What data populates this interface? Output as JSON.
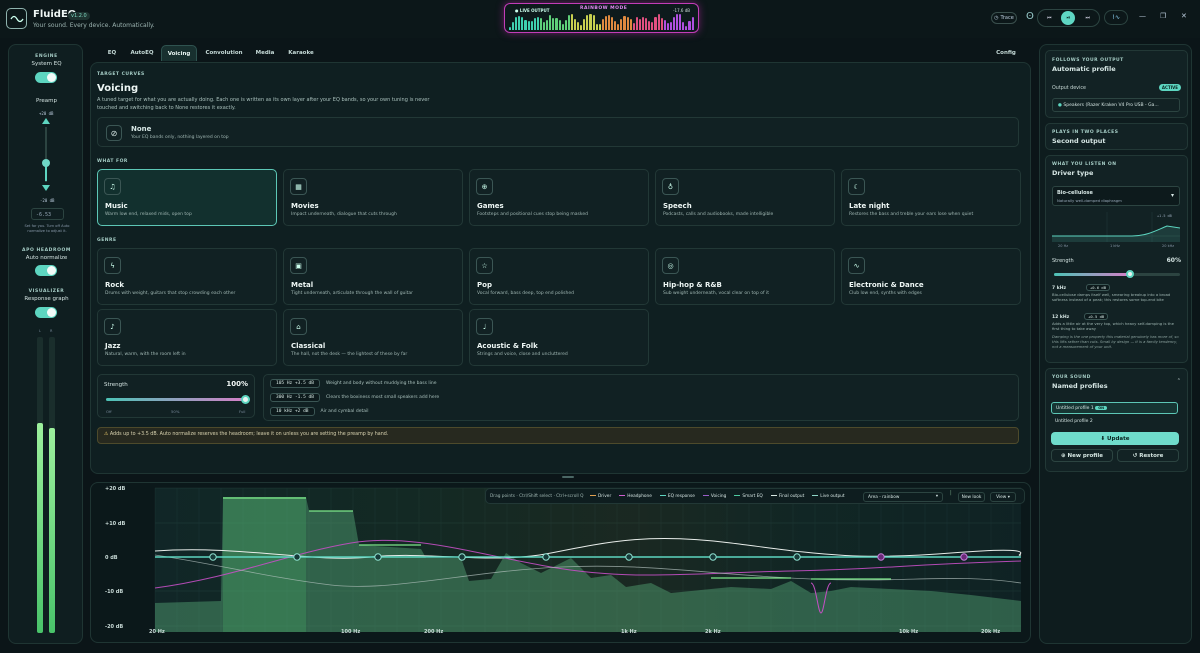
{
  "app": {
    "name": "FluidEQ",
    "version": "v1.2.0",
    "tagline": "Your sound. Every device. Automatically."
  },
  "live": {
    "label": "LIVE OUTPUT",
    "mode": "RAINBOW MODE",
    "level": "-17.6 dB"
  },
  "toolbar": {
    "trace": "Trace"
  },
  "left": {
    "engine_cap": "ENGINE",
    "engine_label": "System EQ",
    "preamp_label": "Preamp",
    "preamp_max": "+20 dB",
    "preamp_min": "-20 dB",
    "preamp_value": "-6.53",
    "preamp_hint": "Set for you. Turn off Auto normalize to adjust it.",
    "headroom_cap": "APO HEADROOM",
    "headroom_label": "Auto normalize",
    "visualizer_cap": "VISUALIZER",
    "visualizer_label": "Response graph",
    "meter_l": "L",
    "meter_r": "R"
  },
  "tabs": [
    "EQ",
    "AutoEQ",
    "Voicing",
    "Convolution",
    "Media",
    "Karaoke"
  ],
  "config_tab": "Config",
  "voicing": {
    "cap": "TARGET CURVES",
    "title": "Voicing",
    "desc": "A tuned target for what you are actually doing. Each one is written as its own layer after your EQ bands, so your own tuning is never touched and switching back to None restores it exactly.",
    "none_title": "None",
    "none_desc": "Your EQ bands only, nothing layered on top",
    "what_for_cap": "WHAT FOR",
    "what_for": [
      {
        "icon": "music-note-icon",
        "glyph": "♫",
        "title": "Music",
        "desc": "Warm low end, relaxed mids, open top"
      },
      {
        "icon": "film-icon",
        "glyph": "▦",
        "title": "Movies",
        "desc": "Impact underneath, dialogue that cuts through"
      },
      {
        "icon": "gamepad-icon",
        "glyph": "⊕",
        "title": "Games",
        "desc": "Footsteps and positional cues stop being masked"
      },
      {
        "icon": "microphone-icon",
        "glyph": "♁",
        "title": "Speech",
        "desc": "Podcasts, calls and audiobooks, made intelligible"
      },
      {
        "icon": "moon-icon",
        "glyph": "☾",
        "title": "Late night",
        "desc": "Restores the bass and treble your ears lose when quiet"
      }
    ],
    "genre_cap": "GENRE",
    "genres": [
      {
        "icon": "lightning-icon",
        "glyph": "ϟ",
        "title": "Rock",
        "desc": "Drums with weight, guitars that stop crowding each other"
      },
      {
        "icon": "amp-icon",
        "glyph": "▣",
        "title": "Metal",
        "desc": "Tight underneath, articulate through the wall of guitar"
      },
      {
        "icon": "star-icon",
        "glyph": "☆",
        "title": "Pop",
        "desc": "Vocal forward, bass deep, top end polished"
      },
      {
        "icon": "vinyl-icon",
        "glyph": "◎",
        "title": "Hip-hop & R&B",
        "desc": "Sub weight underneath, vocal clear on top of it"
      },
      {
        "icon": "pulse-icon",
        "glyph": "∿",
        "title": "Electronic & Dance",
        "desc": "Club low end, synths with edges"
      },
      {
        "icon": "saxophone-icon",
        "glyph": "♪",
        "title": "Jazz",
        "desc": "Natural, warm, with the room left in"
      },
      {
        "icon": "column-icon",
        "glyph": "⌂",
        "title": "Classical",
        "desc": "The hall, not the desk — the lightest of these by far"
      },
      {
        "icon": "guitar-icon",
        "glyph": "♩",
        "title": "Acoustic & Folk",
        "desc": "Strings and voice, close and uncluttered"
      }
    ],
    "strength_label": "Strength",
    "strength_value": "100%",
    "strength_fraction": 1.0,
    "scale": [
      "Off",
      "50%",
      "Full"
    ],
    "bands": [
      {
        "chip": "105 Hz +3.5 dB",
        "desc": "Weight and body without muddying the bass line"
      },
      {
        "chip": "300 Hz -1.5 dB",
        "desc": "Clears the boxiness most small speakers add here"
      },
      {
        "chip": "10 kHz +2 dB",
        "desc": "Air and cymbal detail"
      }
    ],
    "warning": "Adds up to +3.5 dB. Auto normalize reserves the headroom; leave it on unless you are setting the preamp by hand."
  },
  "graph": {
    "y_labels": [
      "+20 dB",
      "+10 dB",
      "0 dB",
      "-10 dB",
      "-20 dB"
    ],
    "x_labels": [
      "20 Hz",
      "100 Hz",
      "200 Hz",
      "1k Hz",
      "2k Hz",
      "10k Hz",
      "20k Hz"
    ],
    "hint": "Drag points · Ctrl/Shift select · Ctrl+scroll Q",
    "legend": [
      {
        "name": "Driver",
        "color": "#e0a050"
      },
      {
        "name": "Headphone",
        "color": "#d05fd0"
      },
      {
        "name": "EQ response",
        "color": "#5dd5c0"
      },
      {
        "name": "Voicing",
        "color": "#9a5fc8"
      },
      {
        "name": "Smart EQ",
        "color": "#4ec9a0"
      },
      {
        "name": "Final output",
        "color": "#d8e8e4"
      },
      {
        "name": "Live output",
        "color": "#8fd6c8"
      }
    ],
    "dropdown": "Area - rainbow",
    "new_look": "New look",
    "view": "View"
  },
  "right": {
    "follow_cap": "FOLLOWS YOUR OUTPUT",
    "follow_title": "Automatic profile",
    "output_label": "Output device",
    "active": "ACTIVE",
    "device": "Speakers (Razer Kraken V4 Pro USB - Ga...",
    "two_cap": "PLAYS IN TWO PLACES",
    "two_title": "Second output",
    "driver_cap": "WHAT YOU LISTEN ON",
    "driver_title": "Driver type",
    "driver_sel": "Bio-cellulose",
    "driver_sub": "Naturally well-damped diaphragm",
    "mini_val": "+1.5 dB",
    "mini_x": [
      "20 Hz",
      "1 kHz",
      "20 kHz"
    ],
    "strength_label": "Strength",
    "strength_value": "60%",
    "strength_fraction": 0.6,
    "notes": [
      {
        "f": "7 kHz",
        "chip": "+0.6 dB",
        "text": "Bio-cellulose damps itself well, smearing breakup into a broad softness instead of a peak; this restores some top-end bite"
      },
      {
        "f": "12 kHz",
        "chip": "+0.5 dB",
        "text": "Adds a little air at the very top, which heavy self-damping is the first thing to take away"
      }
    ],
    "footnote": "Damping is the one property this material genuinely has more of, so this lifts rather than cuts. Small by design — it is a family tendency, not a measurement of your unit.",
    "sound_cap": "YOUR SOUND",
    "sound_title": "Named profiles",
    "profile1": "Untitled profile 1",
    "on": "ON",
    "profile2": "Untitled profile 2",
    "update": "Update",
    "new_profile": "New profile",
    "restore": "Restore"
  }
}
